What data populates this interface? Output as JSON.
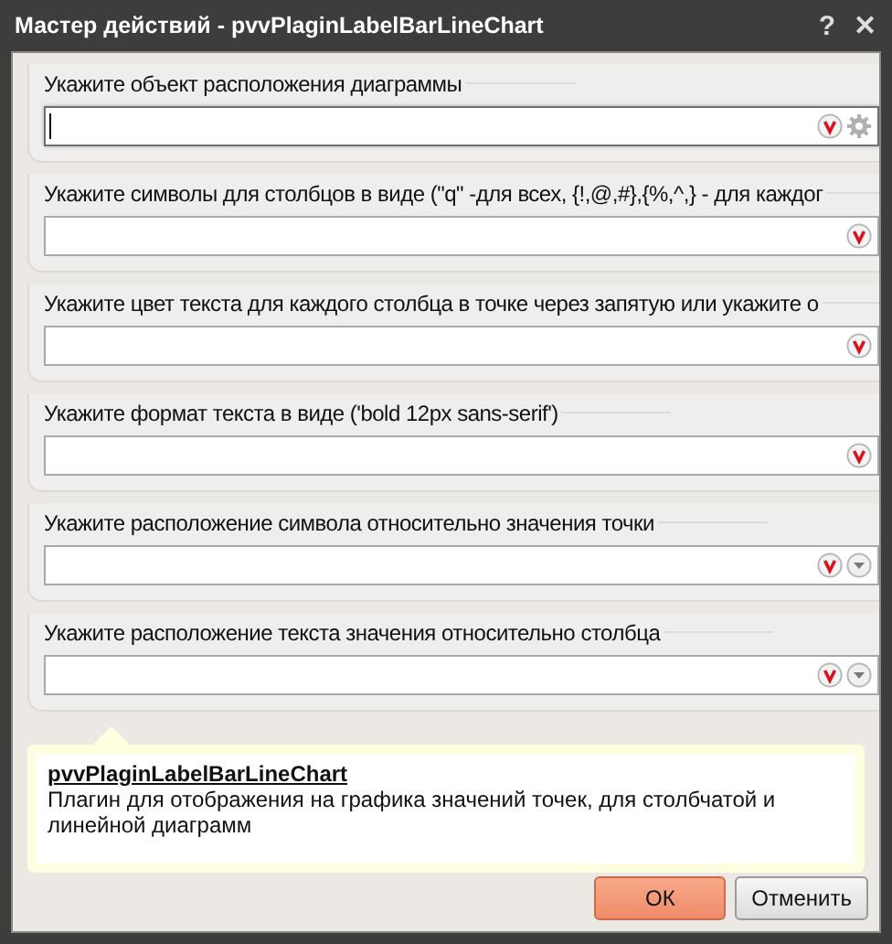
{
  "window": {
    "title": "Мастер действий - pvvPlaginLabelBarLineChart",
    "help": "?",
    "close": "✕"
  },
  "fields": [
    {
      "label": "Укажите объект расположения диаграммы",
      "kind": "picker",
      "focused": true
    },
    {
      "label": "Укажите символы для столбцов в виде (\"q\" -для всех, {!,@,#},{%,^,} - для каждог",
      "kind": "text",
      "focused": false
    },
    {
      "label": "Укажите цвет текста для каждого столбца в точке через запятую или укажите о",
      "kind": "text",
      "focused": false
    },
    {
      "label": "Укажите формат текста в виде ('bold 12px sans-serif')",
      "kind": "text",
      "focused": false
    },
    {
      "label": "Укажите расположение символа относительно значения точки",
      "kind": "dropdown",
      "focused": false
    },
    {
      "label": "Укажите расположение текста значения относительно столбца",
      "kind": "dropdown",
      "focused": false
    }
  ],
  "info": {
    "title": "pvvPlaginLabelBarLineChart",
    "text": "Плагин для отображения на графика значений точек, для столбчатой и линейной диаграмм"
  },
  "buttons": [
    {
      "label": "ОК",
      "primary": true
    },
    {
      "label": "Отменить",
      "primary": false
    }
  ]
}
